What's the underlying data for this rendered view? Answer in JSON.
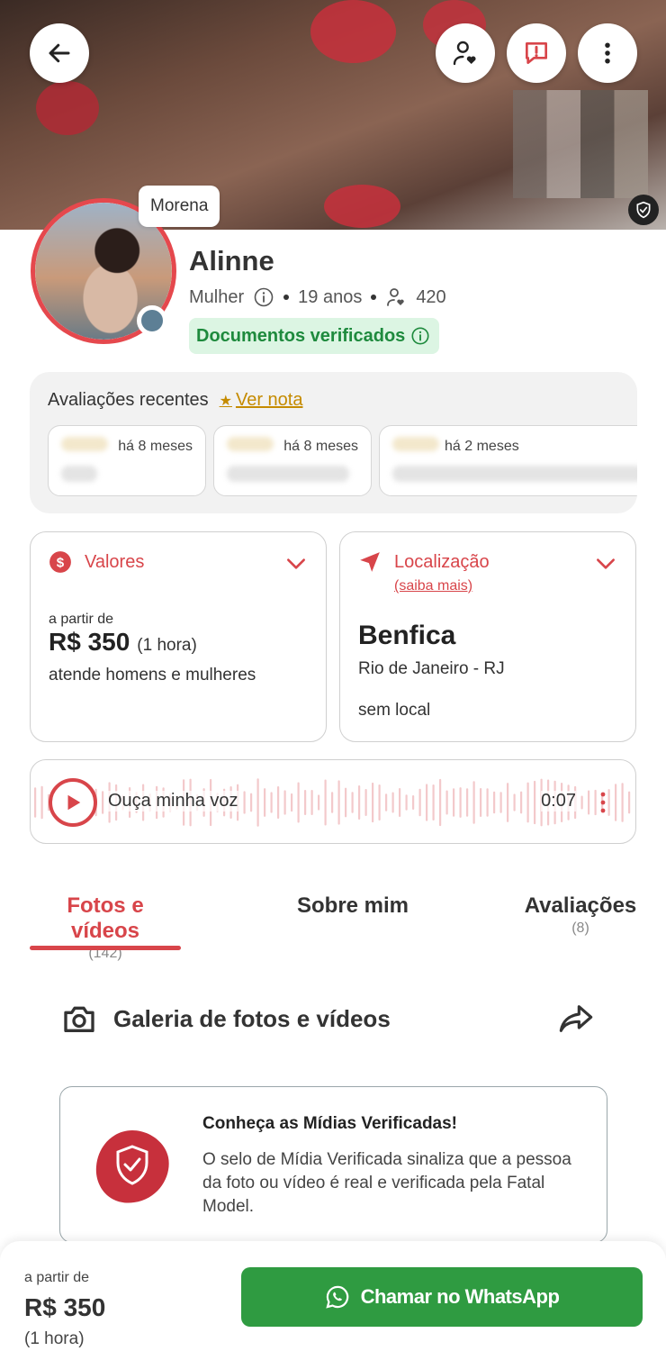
{
  "header": {
    "back_icon": "arrow-left-icon",
    "follow_icon": "user-heart-icon",
    "report_icon": "alert-bubble-icon",
    "more_icon": "vertical-dots-icon",
    "cover_badge_icon": "shield-check-icon"
  },
  "profile": {
    "tag": "Morena",
    "name": "Alinne",
    "gender": "Mulher",
    "age": "19 anos",
    "followers": "420",
    "verified_label": "Documentos verificados"
  },
  "reviews": {
    "title": "Avaliações recentes",
    "ver_nota": "Ver nota",
    "items": [
      {
        "when": "há 8 meses"
      },
      {
        "when": "há 8 meses"
      },
      {
        "when": "há 2 meses"
      }
    ]
  },
  "valores": {
    "title": "Valores",
    "from": "a partir de",
    "price": "R$ 350",
    "duration": "(1 hora)",
    "serves": "atende homens e mulheres"
  },
  "localizacao": {
    "title": "Localização",
    "learn_more": "(saiba mais)",
    "neighborhood": "Benfica",
    "city": "Rio de Janeiro - RJ",
    "place": "sem local"
  },
  "voice": {
    "label": "Ouça minha voz",
    "time": "0:07"
  },
  "tabs": [
    {
      "label": "Fotos e vídeos",
      "count": "(142)"
    },
    {
      "label": "Sobre mim",
      "count": ""
    },
    {
      "label": "Avaliações",
      "count": "(8)"
    }
  ],
  "gallery": {
    "title": "Galeria de fotos e vídeos"
  },
  "media_info": {
    "title": "Conheça as Mídias Verificadas!",
    "text": "O selo de Mídia Verificada sinaliza que a pessoa da foto ou vídeo é real e verificada pela Fatal Model."
  },
  "bottom": {
    "from": "a partir de",
    "price": "R$ 350",
    "duration": "(1 hora)",
    "whatsapp_label": "Chamar no WhatsApp"
  },
  "colors": {
    "accent_red": "#d8454a",
    "verified_green": "#1e8a3d",
    "whatsapp_green": "#2f9b41",
    "star_gold": "#c58b00"
  }
}
